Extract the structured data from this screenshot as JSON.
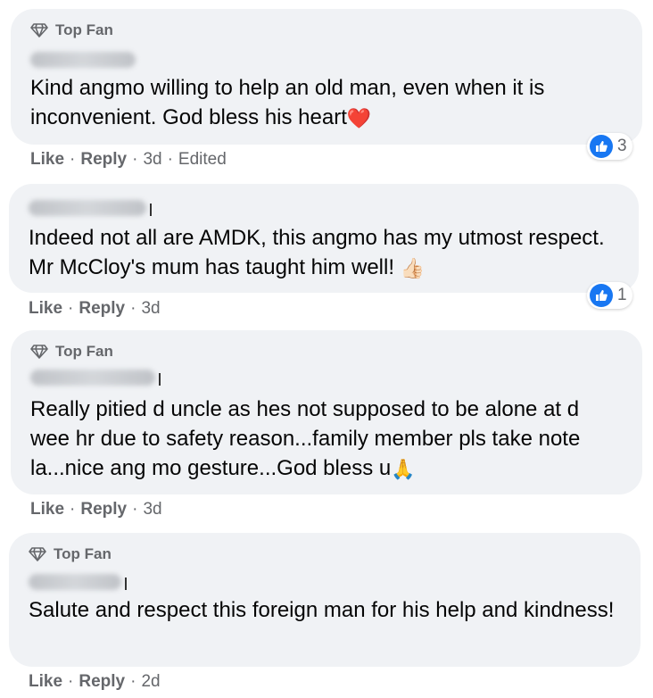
{
  "colors": {
    "bubble_bg": "#f0f2f5",
    "secondary_text": "#65676b",
    "like_blue": "#1877f2",
    "heart_red": "#e41e3f"
  },
  "comments": [
    {
      "badge": "Top Fan",
      "text": "Kind angmo willing to help an old man, even when it is inconvenient. God bless his heart",
      "emoji": "❤️",
      "actions": {
        "like": "Like",
        "reply": "Reply",
        "time": "3d",
        "edited": "Edited"
      },
      "reaction_icon": "like-icon",
      "reaction_count": "3"
    },
    {
      "badge": "",
      "text": "Indeed not all are AMDK, this angmo has my utmost respect. Mr McCloy's mum has taught him well!",
      "emoji": "👍🏻",
      "actions": {
        "like": "Like",
        "reply": "Reply",
        "time": "3d"
      },
      "reaction_icon": "like-icon",
      "reaction_count": "1"
    },
    {
      "badge": "Top Fan",
      "text": "Really pitied d uncle as hes not supposed to be alone at d wee hr due to safety reason...family member pls take note la...nice ang mo gesture...God bless u",
      "emoji": "🙏",
      "actions": {
        "like": "Like",
        "reply": "Reply",
        "time": "3d"
      }
    },
    {
      "badge": "Top Fan",
      "text": "Salute and respect this foreign man for his help and kindness!",
      "emoji": "",
      "actions": {
        "like": "Like",
        "reply": "Reply",
        "time": "2d"
      }
    }
  ]
}
